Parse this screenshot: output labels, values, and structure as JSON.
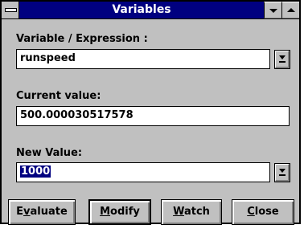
{
  "window": {
    "title": "Variables"
  },
  "fields": {
    "expression_label": "Variable / Expression :",
    "expression_value": "runspeed",
    "current_label": "Current value:",
    "current_value": "500.000030517578",
    "new_label": "New Value:",
    "new_value": "1000"
  },
  "buttons": {
    "evaluate": {
      "pre": "E",
      "key": "v",
      "post": "aluate"
    },
    "modify": {
      "pre": "",
      "key": "M",
      "post": "odify"
    },
    "watch": {
      "pre": "",
      "key": "W",
      "post": "atch"
    },
    "close": {
      "pre": "",
      "key": "C",
      "post": "lose"
    }
  },
  "icons": {
    "system_menu": "system-menu-icon",
    "minimize": "triangle-down-icon",
    "maximize": "triangle-up-icon",
    "dropdown": "dropdown-arrow-icon"
  }
}
